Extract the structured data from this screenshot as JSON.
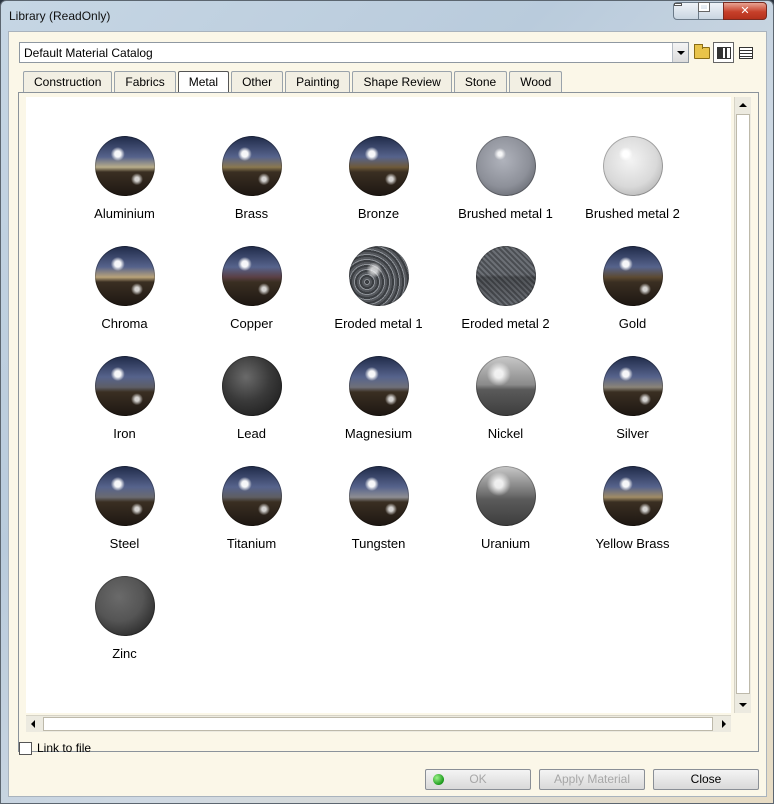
{
  "window": {
    "title": "Library (ReadOnly)"
  },
  "catalog": {
    "selected": "Default Material Catalog"
  },
  "tabs": [
    {
      "label": "Construction",
      "active": false
    },
    {
      "label": "Fabrics",
      "active": false
    },
    {
      "label": "Metal",
      "active": true
    },
    {
      "label": "Other",
      "active": false
    },
    {
      "label": "Painting",
      "active": false
    },
    {
      "label": "Shape Review",
      "active": false
    },
    {
      "label": "Stone",
      "active": false
    },
    {
      "label": "Wood",
      "active": false
    }
  ],
  "materials": [
    {
      "name": "Aluminium",
      "style": "env",
      "tint": "#b8ad8a"
    },
    {
      "name": "Brass",
      "style": "env",
      "tint": "#8a7850"
    },
    {
      "name": "Bronze",
      "style": "env",
      "tint": "#6e5a3a"
    },
    {
      "name": "Brushed metal 1",
      "style": "matte",
      "tint": "#8d9099"
    },
    {
      "name": "Brushed metal 2",
      "style": "bright",
      "tint": "#d9d9d9"
    },
    {
      "name": "Chroma",
      "style": "env",
      "tint": "#b9a37a"
    },
    {
      "name": "Copper",
      "style": "env",
      "tint": "#5a3f44"
    },
    {
      "name": "Eroded metal 1",
      "style": "rough",
      "tint": "#6a6d72"
    },
    {
      "name": "Eroded metal 2",
      "style": "rough2",
      "tint": "#5b5f64"
    },
    {
      "name": "Gold",
      "style": "env",
      "tint": "#5c4a32"
    },
    {
      "name": "Iron",
      "style": "env",
      "tint": "#5d5e66"
    },
    {
      "name": "Lead",
      "style": "dark",
      "tint": "#3a3a3a"
    },
    {
      "name": "Magnesium",
      "style": "env",
      "tint": "#6f7079"
    },
    {
      "name": "Nickel",
      "style": "smooth",
      "tint": "#8a8a8a"
    },
    {
      "name": "Silver",
      "style": "env",
      "tint": "#8a8478"
    },
    {
      "name": "Steel",
      "style": "env",
      "tint": "#6a6a70"
    },
    {
      "name": "Titanium",
      "style": "env",
      "tint": "#5e5e62"
    },
    {
      "name": "Tungsten",
      "style": "env",
      "tint": "#8d8d92"
    },
    {
      "name": "Uranium",
      "style": "smooth",
      "tint": "#6d6d6d"
    },
    {
      "name": "Yellow Brass",
      "style": "env",
      "tint": "#a08c66"
    },
    {
      "name": "Zinc",
      "style": "dark",
      "tint": "#555555"
    }
  ],
  "options": {
    "link_to_file": "Link to file",
    "link_to_file_checked": false
  },
  "buttons": {
    "ok": "OK",
    "apply": "Apply Material",
    "close": "Close"
  },
  "colors": {
    "client_bg": "#fbf7e8",
    "accent_close": "#c7402a"
  }
}
